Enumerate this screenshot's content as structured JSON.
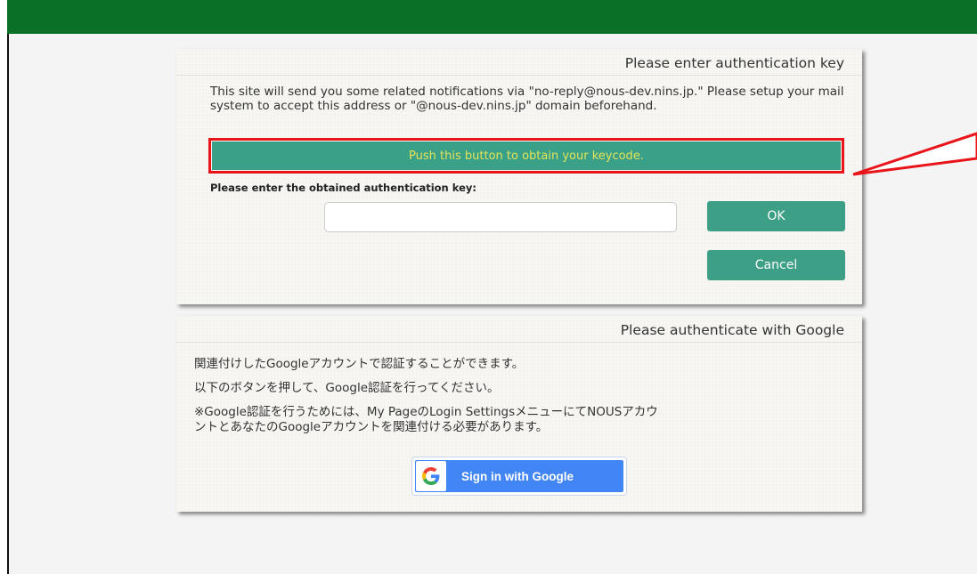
{
  "auth_key_panel": {
    "title": "Please enter authentication key",
    "notice": "This site will send you some related notifications via \"no-reply@nous-dev.nins.jp.\" Please setup your mail system to accept this address or \"@nous-dev.nins.jp\" domain beforehand.",
    "obtain_button_label": "Push this button to obtain your keycode.",
    "key_label": "Please enter the obtained authentication key:",
    "key_input_value": "",
    "ok_label": "OK",
    "cancel_label": "Cancel"
  },
  "google_panel": {
    "title": "Please authenticate with Google",
    "line1": "関連付けしたGoogleアカウントで認証することができます。",
    "line2": "以下のボタンを押して、Google認証を行ってください。",
    "line3a": "※Google認証を行うためには、My PageのLogin SettingsメニューにてNOUSアカウ",
    "line3b": "ントとあなたのGoogleアカウントを関連付ける必要があります。",
    "sign_in_label": "Sign in with Google",
    "sign_in_icon": "google-g-icon"
  },
  "colors": {
    "topbar": "#0a7028",
    "button_green": "#3d9f86",
    "obtain_text": "#e3e35a",
    "highlight_red": "#e8141a",
    "google_blue": "#4285f4"
  }
}
